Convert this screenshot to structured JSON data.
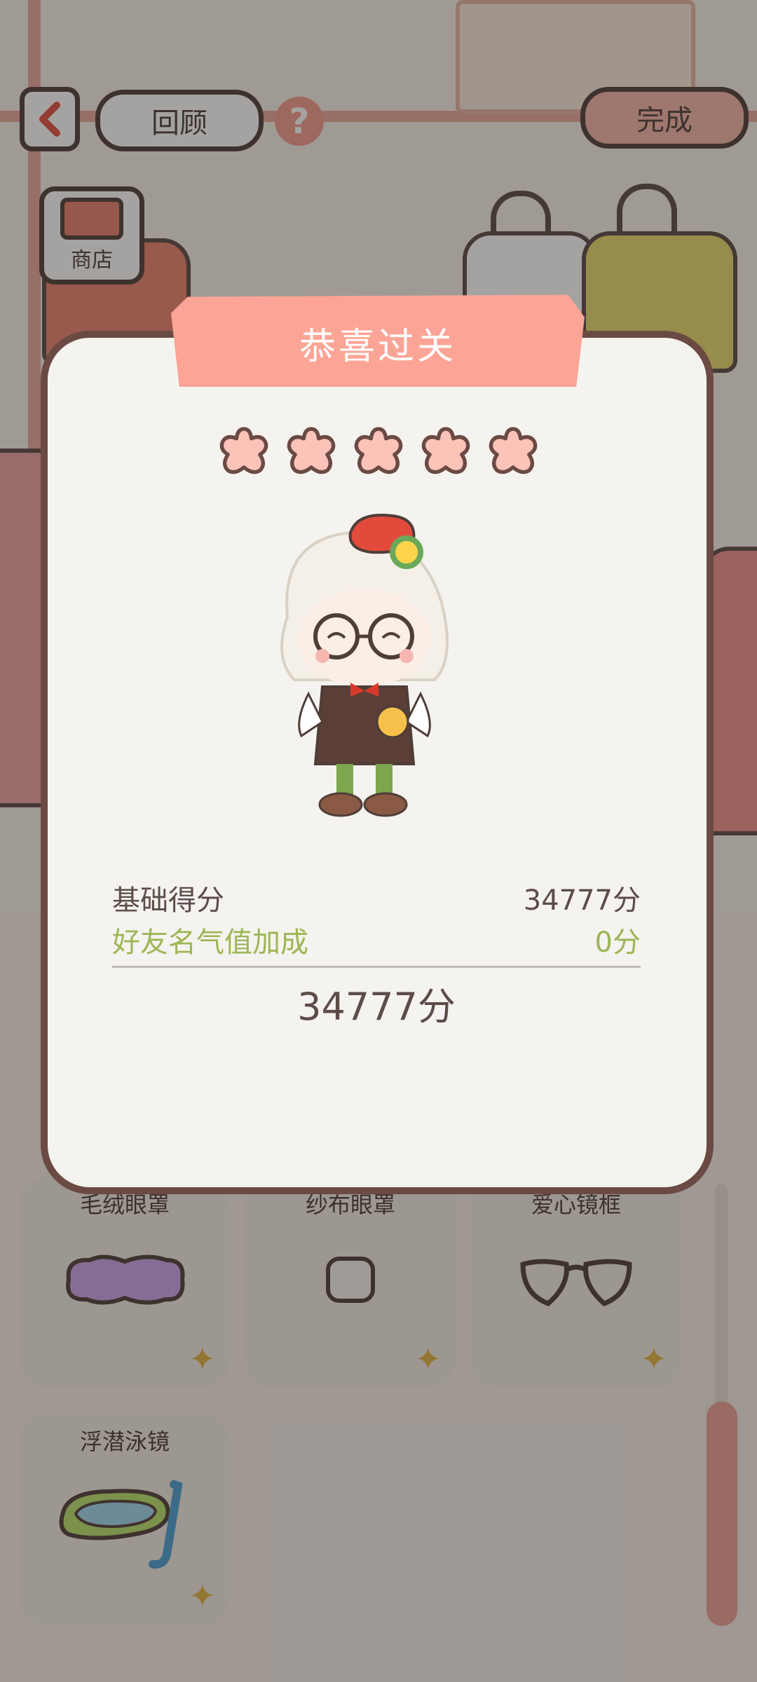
{
  "top_bar": {
    "back_icon": "chevron-left-icon",
    "review_label": "回顾",
    "help_label": "?",
    "done_label": "完成"
  },
  "shop": {
    "label": "商店",
    "icon": "shop-awning-icon"
  },
  "items": [
    {
      "label": "毛绒眼罩",
      "icon": "plush-eye-mask-icon"
    },
    {
      "label": "纱布眼罩",
      "icon": "gauze-eye-patch-icon"
    },
    {
      "label": "爱心镜框",
      "icon": "heart-glasses-icon"
    },
    {
      "label": "浮潜泳镜",
      "icon": "snorkel-goggles-icon"
    }
  ],
  "result": {
    "title": "恭喜过关",
    "stars_earned": 5,
    "stars_total": 5,
    "base_label": "基础得分",
    "base_value": "34777分",
    "bonus_label": "好友名气值加成",
    "bonus_value": "0分",
    "total_value": "34777分"
  },
  "colors": {
    "accent_pink": "#fca596",
    "star_fill": "#fcc3b9",
    "bonus_green": "#9cb655",
    "dialog_border": "#6b4a43"
  }
}
